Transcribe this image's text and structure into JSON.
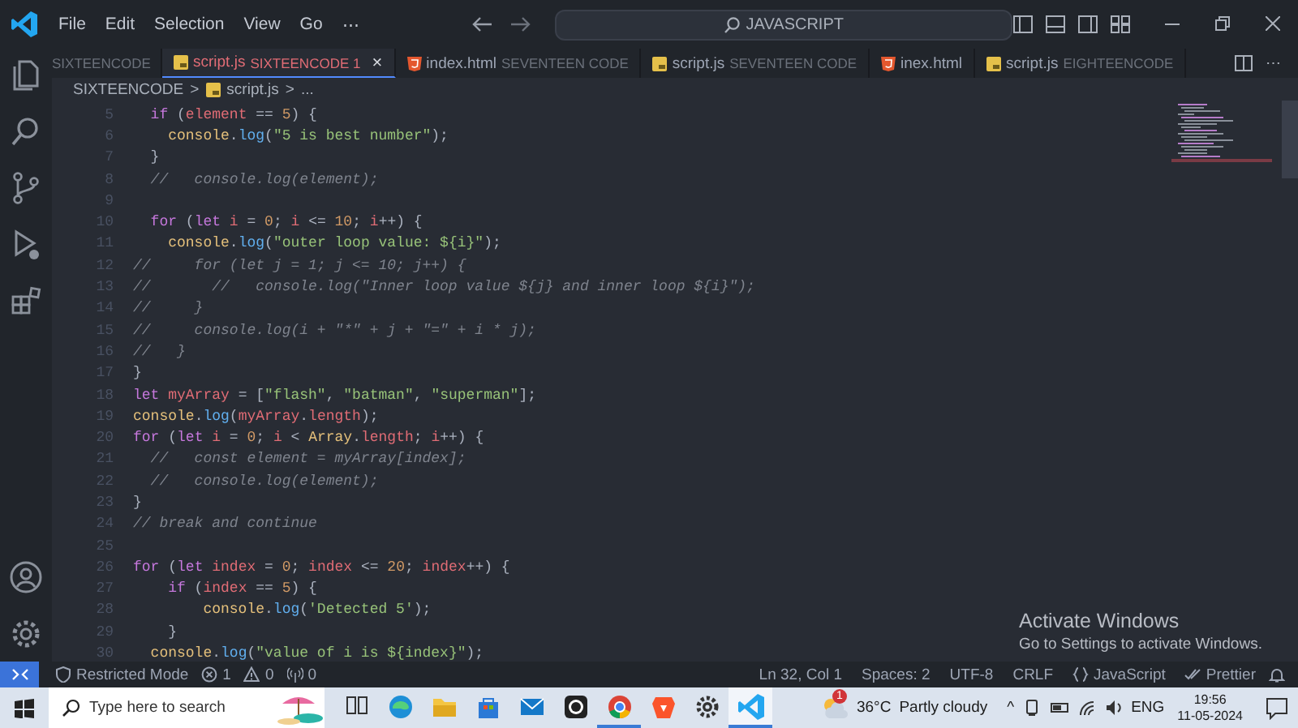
{
  "title_bar": {
    "menu": [
      "File",
      "Edit",
      "Selection",
      "View",
      "Go",
      "⋯"
    ],
    "search": {
      "value": "JAVASCRIPT"
    }
  },
  "activity_bar": {
    "top": [
      {
        "kind": "files"
      },
      {
        "kind": "search"
      },
      {
        "kind": "branch"
      },
      {
        "kind": "debug"
      },
      {
        "kind": "extensions"
      }
    ],
    "bottom": [
      {
        "kind": "account"
      },
      {
        "kind": "gear"
      }
    ]
  },
  "tabs": [
    {
      "description": "SIXTEENCODE",
      "selected": false,
      "has_errors": false
    },
    {
      "label": "script.js",
      "description": "SIXTEENCODE 1",
      "kind": "js",
      "selected": true,
      "has_errors": true,
      "close": "×"
    },
    {
      "label": "index.html",
      "description": "SEVENTEEN CODE",
      "kind": "html",
      "selected": false,
      "has_errors": false
    },
    {
      "label": "script.js",
      "description": "SEVENTEEN CODE",
      "kind": "js",
      "selected": false,
      "has_errors": false
    },
    {
      "label": "inex.html",
      "kind": "html",
      "selected": false,
      "has_errors": false
    },
    {
      "label": "script.js",
      "description": "EIGHTEENCODE",
      "kind": "js",
      "selected": false,
      "has_errors": false
    }
  ],
  "tab_actions": {
    "more": "⋯"
  },
  "breadcrumb": {
    "folder": "SIXTEENCODE",
    "separator_1": ">",
    "file": "script.js",
    "separator_2": ">",
    "symbol": "..."
  },
  "code_lines": [
    {
      "number": "5",
      "tokens": [
        {
          "kind": "keyword",
          "text": "  if"
        },
        {
          "kind": "punct",
          "text": " ("
        },
        {
          "kind": "variable",
          "text": "element"
        },
        {
          "kind": "punct",
          "text": " == "
        },
        {
          "kind": "number",
          "text": "5"
        },
        {
          "kind": "punct",
          "text": ") {"
        }
      ]
    },
    {
      "number": "6",
      "tokens": [
        {
          "kind": "object",
          "text": "    console"
        },
        {
          "kind": "punct",
          "text": "."
        },
        {
          "kind": "function",
          "text": "log"
        },
        {
          "kind": "punct",
          "text": "("
        },
        {
          "kind": "string",
          "text": "\"5 is best number\""
        },
        {
          "kind": "punct",
          "text": ");"
        }
      ]
    },
    {
      "number": "7",
      "tokens": [
        {
          "kind": "punct",
          "text": "  }"
        }
      ]
    },
    {
      "number": "8",
      "tokens": [
        {
          "kind": "comment",
          "text": "  //   console.log(element);"
        }
      ]
    },
    {
      "number": "9"
    },
    {
      "number": "10",
      "tokens": [
        {
          "kind": "keyword",
          "text": "  for"
        },
        {
          "kind": "punct",
          "text": " ("
        },
        {
          "kind": "keyword",
          "text": "let"
        },
        {
          "kind": "variable",
          "text": " i"
        },
        {
          "kind": "punct",
          "text": " = "
        },
        {
          "kind": "number",
          "text": "0"
        },
        {
          "kind": "punct",
          "text": "; "
        },
        {
          "kind": "variable",
          "text": "i"
        },
        {
          "kind": "punct",
          "text": " <= "
        },
        {
          "kind": "number",
          "text": "10"
        },
        {
          "kind": "punct",
          "text": "; "
        },
        {
          "kind": "variable",
          "text": "i"
        },
        {
          "kind": "punct",
          "text": "++) {"
        }
      ]
    },
    {
      "number": "11",
      "tokens": [
        {
          "kind": "object",
          "text": "    console"
        },
        {
          "kind": "punct",
          "text": "."
        },
        {
          "kind": "function",
          "text": "log"
        },
        {
          "kind": "punct",
          "text": "("
        },
        {
          "kind": "string",
          "text": "\"outer loop value: ${i}\""
        },
        {
          "kind": "punct",
          "text": ");"
        }
      ]
    },
    {
      "number": "12",
      "tokens": [
        {
          "kind": "comment",
          "text": "//     for (let j = 1; j <= 10; j++) {"
        }
      ]
    },
    {
      "number": "13",
      "tokens": [
        {
          "kind": "comment",
          "text": "//       //   console.log(\"Inner loop value ${j} and inner loop ${i}\");"
        }
      ]
    },
    {
      "number": "14",
      "tokens": [
        {
          "kind": "comment",
          "text": "//     }"
        }
      ]
    },
    {
      "number": "15",
      "tokens": [
        {
          "kind": "comment",
          "text": "//     console.log(i + \"*\" + j + \"=\" + i * j);"
        }
      ]
    },
    {
      "number": "16",
      "tokens": [
        {
          "kind": "comment",
          "text": "//   }"
        }
      ]
    },
    {
      "number": "17",
      "tokens": [
        {
          "kind": "punct",
          "text": "}"
        }
      ]
    },
    {
      "number": "18",
      "tokens": [
        {
          "kind": "keyword",
          "text": "let"
        },
        {
          "kind": "variable",
          "text": " myArray"
        },
        {
          "kind": "punct",
          "text": " = ["
        },
        {
          "kind": "string",
          "text": "\"flash\""
        },
        {
          "kind": "punct",
          "text": ", "
        },
        {
          "kind": "string",
          "text": "\"batman\""
        },
        {
          "kind": "punct",
          "text": ", "
        },
        {
          "kind": "string",
          "text": "\"superman\""
        },
        {
          "kind": "punct",
          "text": "];"
        }
      ]
    },
    {
      "number": "19",
      "tokens": [
        {
          "kind": "object",
          "text": "console"
        },
        {
          "kind": "punct",
          "text": "."
        },
        {
          "kind": "function",
          "text": "log"
        },
        {
          "kind": "punct",
          "text": "("
        },
        {
          "kind": "variable",
          "text": "myArray"
        },
        {
          "kind": "punct",
          "text": "."
        },
        {
          "kind": "variable",
          "text": "length"
        },
        {
          "kind": "punct",
          "text": ");"
        }
      ]
    },
    {
      "number": "20",
      "tokens": [
        {
          "kind": "keyword",
          "text": "for"
        },
        {
          "kind": "punct",
          "text": " ("
        },
        {
          "kind": "keyword",
          "text": "let"
        },
        {
          "kind": "variable",
          "text": " i"
        },
        {
          "kind": "punct",
          "text": " = "
        },
        {
          "kind": "number",
          "text": "0"
        },
        {
          "kind": "punct",
          "text": "; "
        },
        {
          "kind": "variable",
          "text": "i"
        },
        {
          "kind": "punct",
          "text": " < "
        },
        {
          "kind": "object",
          "text": "Array"
        },
        {
          "kind": "punct",
          "text": "."
        },
        {
          "kind": "variable",
          "text": "length"
        },
        {
          "kind": "punct",
          "text": "; "
        },
        {
          "kind": "variable",
          "text": "i"
        },
        {
          "kind": "punct",
          "text": "++) {"
        }
      ]
    },
    {
      "number": "21",
      "tokens": [
        {
          "kind": "comment",
          "text": "  //   const element = myArray[index];"
        }
      ]
    },
    {
      "number": "22",
      "tokens": [
        {
          "kind": "comment",
          "text": "  //   console.log(element);"
        }
      ]
    },
    {
      "number": "23",
      "tokens": [
        {
          "kind": "punct",
          "text": "}"
        }
      ]
    },
    {
      "number": "24",
      "tokens": [
        {
          "kind": "comment",
          "text": "// break and continue"
        }
      ]
    },
    {
      "number": "25"
    },
    {
      "number": "26",
      "tokens": [
        {
          "kind": "keyword",
          "text": "for"
        },
        {
          "kind": "punct",
          "text": " ("
        },
        {
          "kind": "keyword",
          "text": "let"
        },
        {
          "kind": "variable",
          "text": " index"
        },
        {
          "kind": "punct",
          "text": " = "
        },
        {
          "kind": "number",
          "text": "0"
        },
        {
          "kind": "punct",
          "text": "; "
        },
        {
          "kind": "variable",
          "text": "index"
        },
        {
          "kind": "punct",
          "text": " <= "
        },
        {
          "kind": "number",
          "text": "20"
        },
        {
          "kind": "punct",
          "text": "; "
        },
        {
          "kind": "variable",
          "text": "index"
        },
        {
          "kind": "punct",
          "text": "++) {"
        }
      ]
    },
    {
      "number": "27",
      "tokens": [
        {
          "kind": "keyword",
          "text": "    if"
        },
        {
          "kind": "punct",
          "text": " ("
        },
        {
          "kind": "variable",
          "text": "index"
        },
        {
          "kind": "punct",
          "text": " == "
        },
        {
          "kind": "number",
          "text": "5"
        },
        {
          "kind": "punct",
          "text": ") {"
        }
      ]
    },
    {
      "number": "28",
      "tokens": [
        {
          "kind": "object",
          "text": "        console"
        },
        {
          "kind": "punct",
          "text": "."
        },
        {
          "kind": "function",
          "text": "log"
        },
        {
          "kind": "punct",
          "text": "("
        },
        {
          "kind": "string",
          "text": "'Detected 5'"
        },
        {
          "kind": "punct",
          "text": ");"
        }
      ]
    },
    {
      "number": "29",
      "tokens": [
        {
          "kind": "punct",
          "text": "    }"
        }
      ]
    },
    {
      "number": "30",
      "tokens": [
        {
          "kind": "object",
          "text": "  console"
        },
        {
          "kind": "punct",
          "text": "."
        },
        {
          "kind": "function",
          "text": "log"
        },
        {
          "kind": "punct",
          "text": "("
        },
        {
          "kind": "string",
          "text": "\"value of i is ${index}\""
        },
        {
          "kind": "punct",
          "text": ");"
        }
      ]
    }
  ],
  "activation_notice": {
    "title": "Activate Windows",
    "subtitle": "Go to Settings to activate Windows."
  },
  "status_bar": {
    "left": [
      {
        "kind": "shield",
        "text": "Restricted Mode"
      },
      {
        "kind": "error",
        "text": "1"
      },
      {
        "kind": "warning",
        "text": "0"
      },
      {
        "kind": "antenna",
        "text": "0"
      }
    ],
    "right": [
      {
        "kind": "plain",
        "text": "Ln 32, Col 1"
      },
      {
        "kind": "plain",
        "text": "Spaces: 2"
      },
      {
        "kind": "plain",
        "text": "UTF-8"
      },
      {
        "kind": "plain",
        "text": "CRLF"
      },
      {
        "kind": "braces",
        "text": "JavaScript"
      },
      {
        "kind": "checks",
        "text": "Prettier"
      },
      {
        "kind": "bell"
      }
    ]
  },
  "taskbar": {
    "search": {
      "placeholder": "Type here to search"
    },
    "apps": [
      {
        "kind": "taskview",
        "running": false,
        "selected": false
      },
      {
        "kind": "edge",
        "running": false,
        "selected": false
      },
      {
        "kind": "folder",
        "running": false,
        "selected": false
      },
      {
        "kind": "store",
        "running": false,
        "selected": false
      },
      {
        "kind": "mail",
        "running": false,
        "selected": false
      },
      {
        "kind": "github",
        "running": false,
        "selected": false
      },
      {
        "kind": "chrome",
        "running": true,
        "selected": false
      },
      {
        "kind": "brave",
        "running": false,
        "selected": false
      },
      {
        "kind": "gear",
        "running": false,
        "selected": false
      },
      {
        "kind": "vscode",
        "running": true,
        "selected": true
      }
    ],
    "weather": {
      "badge": "1",
      "temperature": "36°C",
      "condition": "Partly cloudy"
    },
    "tray": {
      "chevron": "^",
      "language": "ENG",
      "time": "19:56",
      "date": "11-05-2024"
    }
  }
}
